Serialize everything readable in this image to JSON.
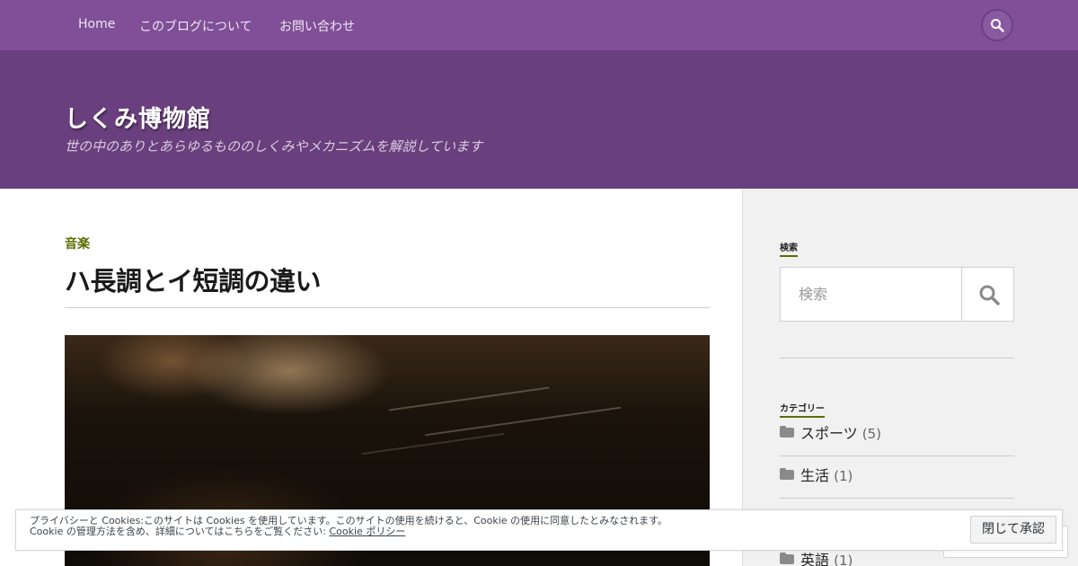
{
  "nav": {
    "items": [
      {
        "label": "Home"
      },
      {
        "label": "このブログについて"
      },
      {
        "label": "お問い合わせ"
      }
    ],
    "search_icon": "search-icon"
  },
  "header": {
    "site_title": "しくみ博物館",
    "site_description": "世の中のありとあらゆるもののしくみやメカニズムを解説しています"
  },
  "post": {
    "category": "音楽",
    "title": "ハ長調とイ短調の違い",
    "image": "piano-photo"
  },
  "sidebar": {
    "search": {
      "title": "検索",
      "placeholder": "検索",
      "icon": "search-icon"
    },
    "categories": {
      "title": "カテゴリー",
      "items": [
        {
          "name": "スポーツ",
          "count": "(5)"
        },
        {
          "name": "生活",
          "count": "(1)"
        },
        {
          "name": "",
          "count": ""
        },
        {
          "name": "英語",
          "count": "(1)"
        }
      ]
    }
  },
  "cookie_banner": {
    "line1": "プライバシーと Cookies:このサイトは Cookies を使用しています。このサイトの使用を続けると、Cookie の使用に同意したとみなされます。",
    "line2": "Cookie の管理方法を含め、詳細についてはこちらをご覧ください: ",
    "link": "Cookie ポリシー",
    "button": "閉じて承認"
  },
  "colors": {
    "nav_bg": "#804f97",
    "header_bg": "#6a3f7d",
    "accent_green": "#5a6e00",
    "sidebar_bg": "#f1f1f1"
  }
}
